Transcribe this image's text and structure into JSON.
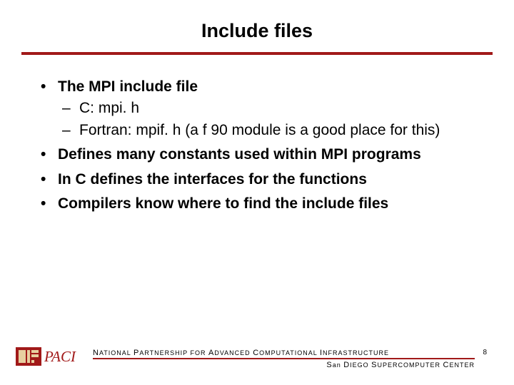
{
  "title": "Include files",
  "bullets": {
    "b1": "The MPI include file",
    "b1a": "C: mpi. h",
    "b1b": "Fortran:  mpif. h (a f 90 module is a good place for this)",
    "b2": "Defines many constants used within MPI programs",
    "b3": "In C defines the interfaces for the functions",
    "b4": "Compilers know where to find the include files"
  },
  "footer": {
    "line1": "NATIONAL PARTNERSHIP FOR ADVANCED COMPUTATIONAL INFRASTRUCTURE",
    "line2": "San DIEGO SUPERCOMPUTER CENTER"
  },
  "page": "8",
  "logo": {
    "text": "NPACI"
  },
  "colors": {
    "accent": "#a11919"
  }
}
